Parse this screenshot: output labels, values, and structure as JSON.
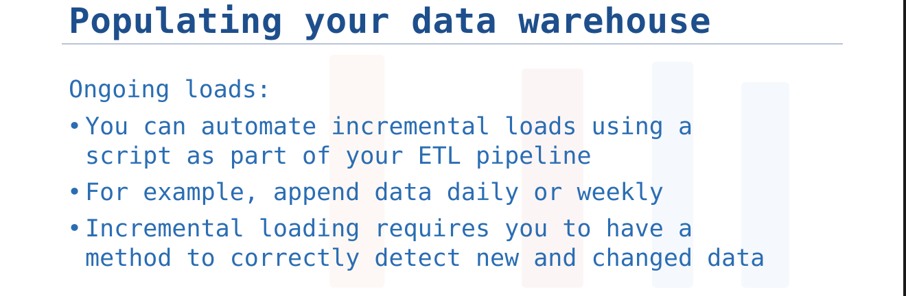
{
  "slide": {
    "title": "Populating your data warehouse",
    "subheading": "Ongoing loads:",
    "bullets": [
      "You can automate incremental loads using a\nscript as part of your ETL pipeline",
      "For example, append data daily or weekly",
      "Incremental loading requires you to have a\nmethod to correctly detect new and changed data"
    ],
    "bullet_glyph": "•"
  },
  "colors": {
    "title": "#1e4f8c",
    "body": "#2a6db3",
    "rule": "#b7c4d8"
  }
}
